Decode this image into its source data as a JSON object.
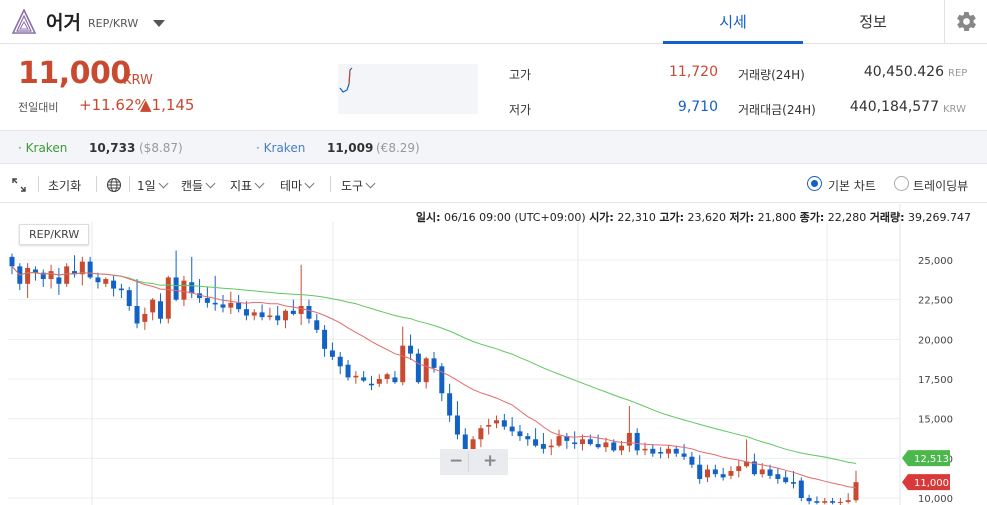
{
  "header": {
    "coin_name": "어거",
    "pair": "REP/KRW",
    "tab_quote": "시세",
    "tab_info": "정보"
  },
  "price": {
    "current": "11,000",
    "unit": "KRW",
    "change_label": "전일대비",
    "change_percent": "+11.62%",
    "change_abs": "▲1,145"
  },
  "stats": {
    "high_label": "고가",
    "high_value": "11,720",
    "low_label": "저가",
    "low_value": "9,710",
    "volume_label": "거래량(24H)",
    "volume_value": "40,450.426",
    "volume_unit": "REP",
    "amount_label": "거래대금(24H)",
    "amount_value": "440,184,577",
    "amount_unit": "KRW"
  },
  "exchanges": [
    {
      "name": "Kraken",
      "price": "10,733",
      "ref": "($8.87)",
      "color": "#3a9a3a"
    },
    {
      "name": "Kraken",
      "price": "11,009",
      "ref": "(€8.29)",
      "color": "#4a7ec0"
    }
  ],
  "toolbar": {
    "reset": "초기화",
    "interval": "1일",
    "candle": "캔들",
    "indicator": "지표",
    "theme": "테마",
    "tools": "도구",
    "basic_chart": "기본 차트",
    "trading_view": "트레이딩뷰"
  },
  "info_bar": {
    "date_label": "일시:",
    "date_value": "06/16 09:00 (UTC+09:00)",
    "open_label": "시가:",
    "open_value": "22,310",
    "high_label": "고가:",
    "high_value": "23,620",
    "low_label": "저가:",
    "low_value": "21,800",
    "close_label": "종가:",
    "close_value": "22,280",
    "volume_label": "거래량:",
    "volume_value": "39,269.747"
  },
  "symbol_label": "REP/KRW",
  "zoom": {
    "minus": "−",
    "plus": "+"
  },
  "colors": {
    "up": "#c84a31",
    "down": "#1261c4",
    "ma_short": "#e36b6b",
    "ma_long": "#5ec85e",
    "accent": "#1261c4"
  },
  "chart_data": {
    "type": "candlestick",
    "y_ticks": [
      "25,000",
      "22,500",
      "20,000",
      "17,500",
      "15,000",
      "12,500",
      "10,000"
    ],
    "y_tick_values": [
      25000,
      22500,
      20000,
      17500,
      15000,
      12500,
      10000
    ],
    "ylim": [
      9500,
      26000
    ],
    "last_price": "11,000",
    "ma_long_label": "12,513",
    "candles": [
      [
        25200,
        25400,
        24100,
        24600
      ],
      [
        24600,
        24800,
        23100,
        23500
      ],
      [
        23500,
        24800,
        22600,
        24500
      ],
      [
        24400,
        24600,
        23700,
        24200
      ],
      [
        24200,
        24400,
        23300,
        23800
      ],
      [
        23800,
        24700,
        23200,
        24300
      ],
      [
        23900,
        24500,
        22800,
        23500
      ],
      [
        23500,
        24800,
        23300,
        24600
      ],
      [
        24300,
        25300,
        23900,
        24100
      ],
      [
        24100,
        25200,
        23400,
        24900
      ],
      [
        24900,
        25200,
        23800,
        23900
      ],
      [
        23900,
        24200,
        23200,
        23600
      ],
      [
        23500,
        23900,
        23300,
        23800
      ],
      [
        23700,
        24000,
        22700,
        23200
      ],
      [
        23200,
        23500,
        22600,
        23100
      ],
      [
        23100,
        23300,
        21800,
        22100
      ],
      [
        22100,
        23800,
        20700,
        21000
      ],
      [
        21100,
        22000,
        20600,
        21600
      ],
      [
        21700,
        22600,
        21200,
        22500
      ],
      [
        22400,
        22900,
        21000,
        21300
      ],
      [
        21300,
        24000,
        21000,
        23900
      ],
      [
        23900,
        25600,
        22400,
        22500
      ],
      [
        22500,
        24000,
        22100,
        23700
      ],
      [
        23600,
        25200,
        22600,
        22900
      ],
      [
        22900,
        23800,
        22300,
        22600
      ],
      [
        22600,
        23300,
        22000,
        22300
      ],
      [
        22300,
        24000,
        21800,
        22200
      ],
      [
        22200,
        22800,
        21700,
        22000
      ],
      [
        22000,
        23000,
        21600,
        22300
      ],
      [
        22300,
        22800,
        21700,
        21900
      ],
      [
        21900,
        22400,
        21200,
        21500
      ],
      [
        21500,
        21900,
        21200,
        21700
      ],
      [
        21700,
        22200,
        21200,
        21400
      ],
      [
        21400,
        22000,
        21200,
        21500
      ],
      [
        21500,
        22100,
        20900,
        21200
      ],
      [
        21200,
        21900,
        20700,
        21800
      ],
      [
        21800,
        22500,
        21500,
        21600
      ],
      [
        21600,
        24700,
        20900,
        22100
      ],
      [
        22100,
        22500,
        21000,
        21300
      ],
      [
        21200,
        21600,
        20400,
        20600
      ],
      [
        20600,
        20900,
        18900,
        19400
      ],
      [
        19300,
        19800,
        18700,
        18900
      ],
      [
        18900,
        19200,
        17800,
        18300
      ],
      [
        18400,
        18700,
        17400,
        17600
      ],
      [
        17600,
        18000,
        17200,
        17700
      ],
      [
        17600,
        18000,
        17300,
        17400
      ],
      [
        17200,
        17700,
        16800,
        17100
      ],
      [
        17200,
        17800,
        17000,
        17500
      ],
      [
        17500,
        17900,
        17200,
        17800
      ],
      [
        17600,
        18000,
        17200,
        17300
      ],
      [
        17300,
        20800,
        17100,
        19600
      ],
      [
        19600,
        20300,
        18700,
        19100
      ],
      [
        19100,
        19400,
        17200,
        17300
      ],
      [
        17300,
        18900,
        16900,
        18800
      ],
      [
        18800,
        19200,
        17900,
        18200
      ],
      [
        18300,
        18500,
        16100,
        16600
      ],
      [
        16600,
        17200,
        14800,
        15200
      ],
      [
        15200,
        16100,
        13700,
        14000
      ],
      [
        14000,
        14400,
        12700,
        12900
      ],
      [
        12900,
        13900,
        12600,
        13700
      ],
      [
        13700,
        14600,
        13200,
        14400
      ],
      [
        14500,
        15000,
        14000,
        14600
      ],
      [
        14700,
        15200,
        14400,
        14900
      ],
      [
        14900,
        15300,
        14300,
        14500
      ],
      [
        14500,
        15100,
        13900,
        14200
      ],
      [
        14200,
        14600,
        13600,
        13900
      ],
      [
        13900,
        14100,
        13300,
        13700
      ],
      [
        13700,
        14400,
        13200,
        13300
      ],
      [
        13400,
        14100,
        12800,
        13100
      ],
      [
        13200,
        13700,
        12700,
        13300
      ],
      [
        13300,
        14300,
        13200,
        13900
      ],
      [
        13900,
        14100,
        13100,
        13600
      ],
      [
        13500,
        14200,
        13100,
        13400
      ],
      [
        13400,
        14000,
        13000,
        13700
      ],
      [
        13700,
        14000,
        13300,
        13400
      ],
      [
        13400,
        14000,
        13100,
        13200
      ],
      [
        13200,
        13800,
        12900,
        13500
      ],
      [
        13500,
        13700,
        12900,
        13000
      ],
      [
        13000,
        13600,
        12700,
        13300
      ],
      [
        13300,
        15800,
        12900,
        14100
      ],
      [
        14100,
        14400,
        12700,
        13000
      ],
      [
        13000,
        13500,
        12700,
        13100
      ],
      [
        13100,
        13400,
        12600,
        12800
      ],
      [
        12900,
        13200,
        12500,
        12800
      ],
      [
        12800,
        13300,
        12500,
        13100
      ],
      [
        13100,
        13300,
        12600,
        12800
      ],
      [
        12800,
        13400,
        12400,
        12600
      ],
      [
        12600,
        12900,
        11900,
        12100
      ],
      [
        12100,
        12700,
        10900,
        11200
      ],
      [
        11300,
        12100,
        11000,
        11800
      ],
      [
        11800,
        12100,
        11300,
        11500
      ],
      [
        11500,
        11900,
        11100,
        11300
      ],
      [
        11400,
        12000,
        11200,
        11700
      ],
      [
        11700,
        12400,
        11300,
        12000
      ],
      [
        12000,
        13700,
        11900,
        12300
      ],
      [
        12300,
        12800,
        11400,
        11500
      ],
      [
        11500,
        12200,
        11300,
        11800
      ],
      [
        11800,
        12100,
        11200,
        11400
      ],
      [
        11500,
        11900,
        10900,
        11200
      ],
      [
        11300,
        11700,
        10900,
        11000
      ],
      [
        11000,
        11700,
        10600,
        10900
      ],
      [
        11100,
        11300,
        9800,
        10000
      ],
      [
        10000,
        10200,
        9600,
        9800
      ],
      [
        9800,
        10100,
        9600,
        9700
      ],
      [
        9700,
        10000,
        9600,
        9800
      ],
      [
        9800,
        10000,
        9600,
        9700
      ],
      [
        9700,
        10000,
        9500,
        9750
      ],
      [
        9750,
        10300,
        9650,
        9860
      ],
      [
        9860,
        11720,
        9710,
        11000
      ]
    ]
  }
}
